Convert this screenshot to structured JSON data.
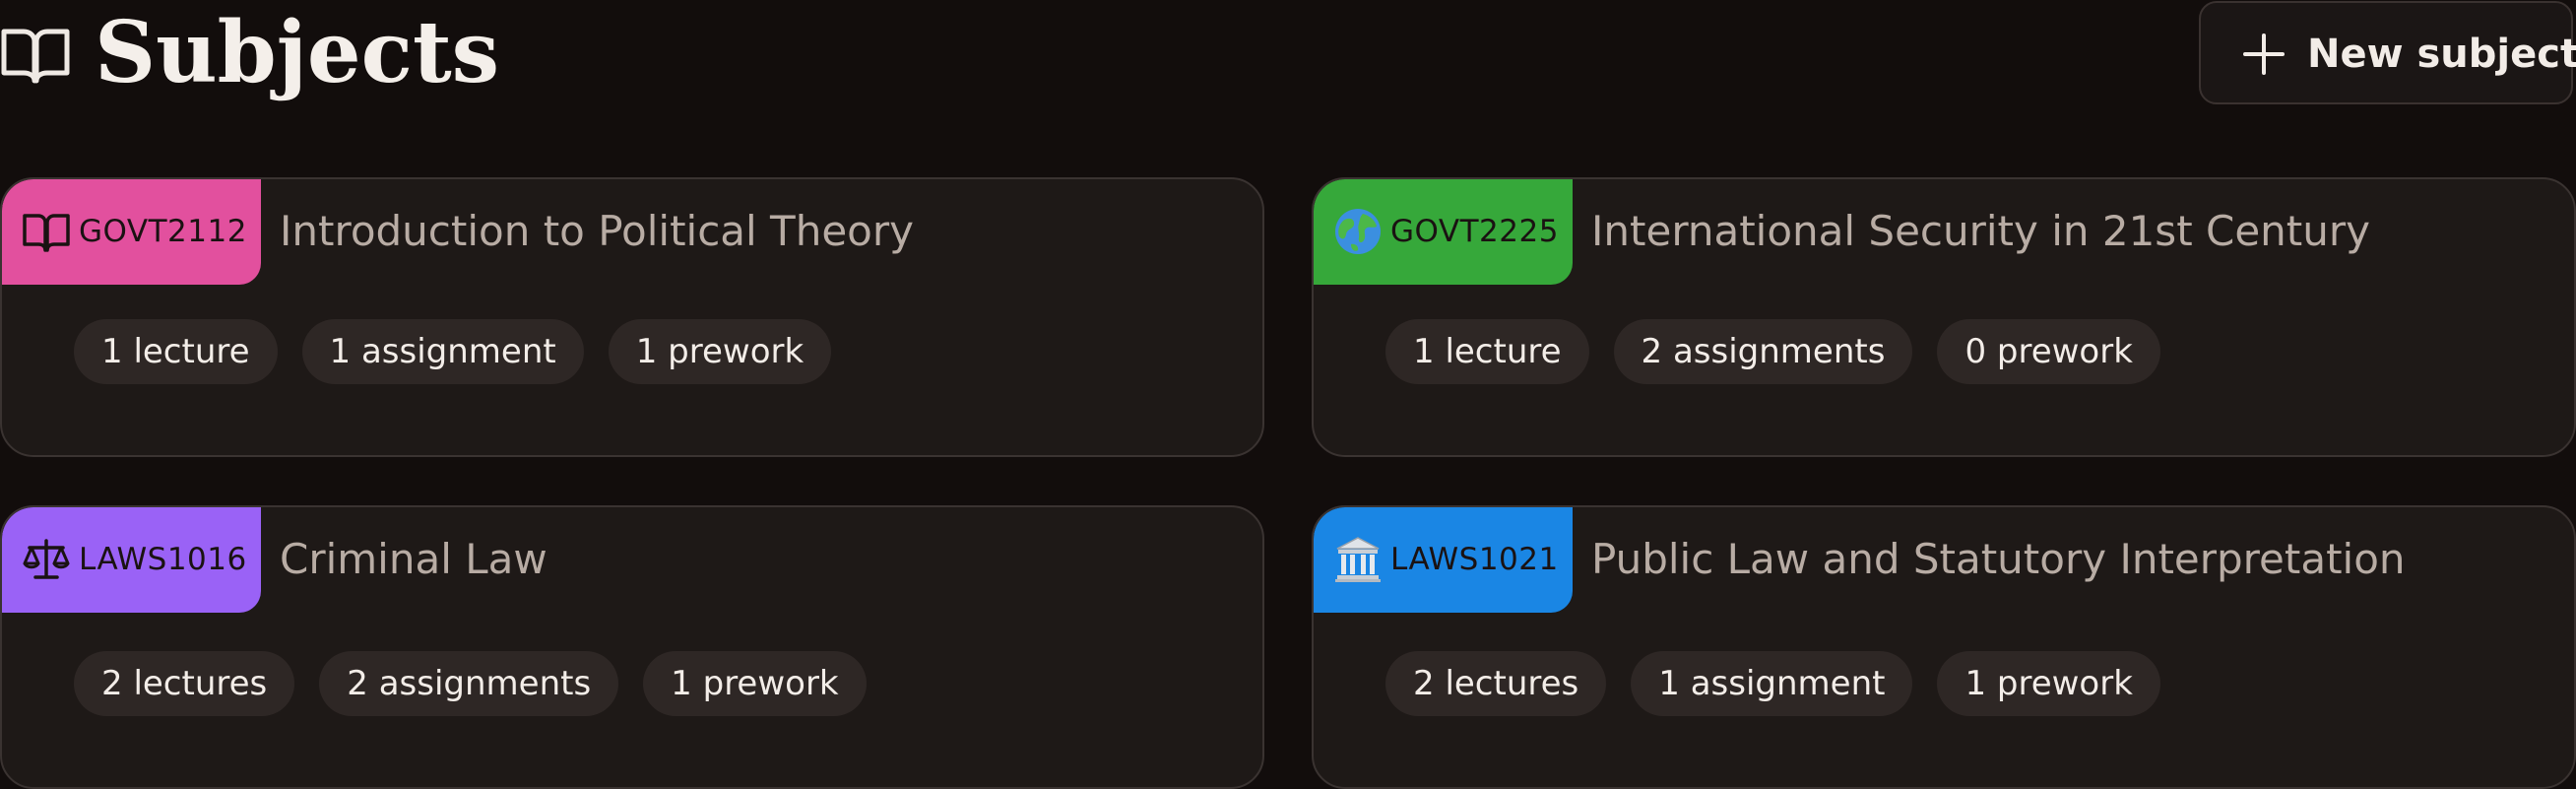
{
  "header": {
    "title": "Subjects",
    "title_icon": "book-open-icon",
    "new_button_label": "New subject",
    "new_button_icon": "plus-icon"
  },
  "subjects": [
    {
      "code": "GOVT2112",
      "title": "Introduction to Political Theory",
      "icon": "book-open-icon",
      "color": "#e2509e",
      "chips": [
        "1 lecture",
        "1 assignment",
        "1 prework"
      ]
    },
    {
      "code": "GOVT2225",
      "title": "International Security in 21st Century",
      "icon": "globe-icon",
      "color": "#36a83a",
      "chips": [
        "1 lecture",
        "2 assignments",
        "0 prework"
      ]
    },
    {
      "code": "LAWS1016",
      "title": "Criminal Law",
      "icon": "scales-icon",
      "color": "#9a62f6",
      "chips": [
        "2 lectures",
        "2 assignments",
        "1 prework"
      ]
    },
    {
      "code": "LAWS1021",
      "title": "Public Law and Statutory Interpretation",
      "icon": "classical-building-icon",
      "color": "#1a86e4",
      "chips": [
        "2 lectures",
        "1 assignment",
        "1 prework"
      ]
    }
  ]
}
